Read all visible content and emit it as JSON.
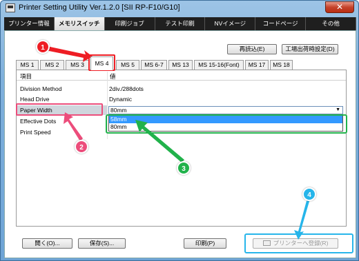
{
  "window": {
    "title": "Printer Setting Utility Ver.1.2.0 [SII RP-F10/G10]",
    "close_glyph": "✕"
  },
  "main_tabs": [
    {
      "label": "プリンター情報"
    },
    {
      "label": "メモリスイッチ"
    },
    {
      "label": "印刷ジョブ"
    },
    {
      "label": "テスト印刷"
    },
    {
      "label": "NVイメージ"
    },
    {
      "label": "コードページ"
    },
    {
      "label": "その他"
    }
  ],
  "top_buttons": {
    "reload": "再読込(E)",
    "factory": "工場出荷時設定(D)"
  },
  "ms_tabs": [
    "MS 1",
    "MS 2",
    "MS 3",
    "MS 4",
    "MS 5",
    "MS 6-7",
    "MS 13",
    "MS 15-16(Font)",
    "MS 17",
    "MS 18"
  ],
  "grid": {
    "header_item": "項目",
    "header_value": "値",
    "rows": [
      {
        "label": "Division Method",
        "value": "2div./288dots"
      },
      {
        "label": "Head Drive",
        "value": "Dynamic"
      },
      {
        "label": "Paper Width",
        "value": "80mm"
      },
      {
        "label": "Effective Dots",
        "value": ""
      },
      {
        "label": "Print Speed",
        "value": ""
      }
    ]
  },
  "combo": {
    "value": "80mm",
    "arrow": "▼",
    "options": [
      "58mm",
      "80mm"
    ]
  },
  "bottom_buttons": {
    "open": "開く(O)...",
    "save": "保存(S)...",
    "print": "印刷(P)",
    "register": "プリンターへ登録(R)"
  },
  "annotations": {
    "badges": [
      "1",
      "2",
      "3",
      "4"
    ],
    "colors": {
      "step1": "#ee1d24",
      "step2": "#ec4d7b",
      "step3": "#21b24b",
      "step4": "#26b5ea"
    }
  }
}
